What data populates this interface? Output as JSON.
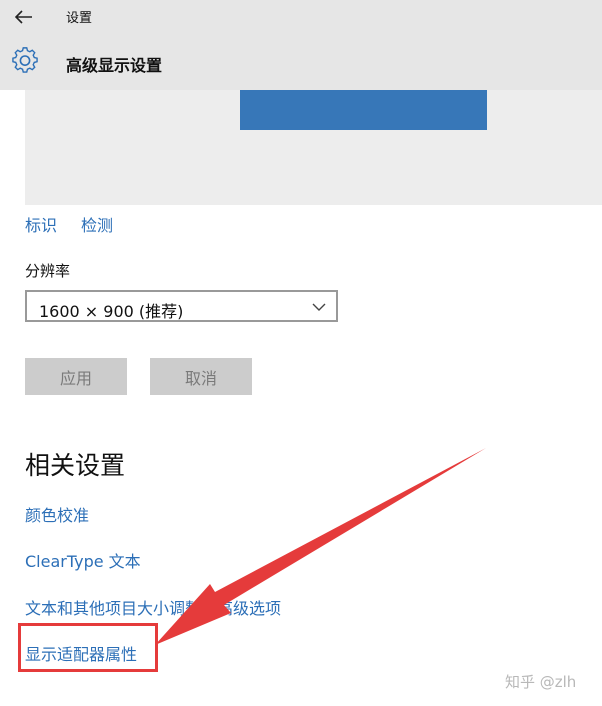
{
  "window": {
    "app_title": "设置",
    "page_title": "高级显示设置"
  },
  "display_preview": {
    "links": {
      "identify": "标识",
      "detect": "检测"
    },
    "monitor_color": "#3777b8"
  },
  "resolution": {
    "label": "分辨率",
    "selected": "1600 × 900 (推荐)"
  },
  "actions": {
    "apply": "应用",
    "cancel": "取消"
  },
  "related_settings": {
    "heading": "相关设置",
    "items": [
      "颜色校准",
      "ClearType 文本",
      "文本和其他项目大小调整的高级选项",
      "显示适配器属性"
    ]
  },
  "annotation": {
    "highlight_color": "#e53b3b"
  },
  "watermark": "知乎 @zlh"
}
